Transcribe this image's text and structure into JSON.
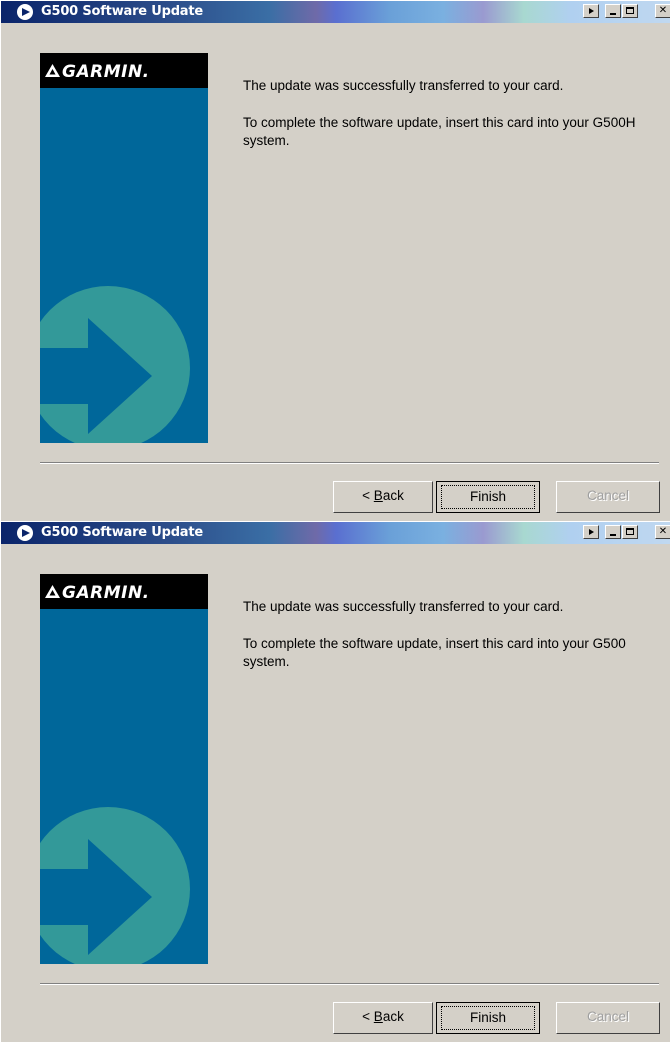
{
  "windows": [
    {
      "title": "G500 Software Update",
      "logo_text": "GARMIN.",
      "message_line1": "The update was successfully transferred to your card.",
      "message_line2": "To complete the software update, insert this card into your G500H system.",
      "back_label_prefix": "< ",
      "back_label_accel": "B",
      "back_label_rest": "ack",
      "finish_label": "Finish",
      "cancel_label": "Cancel"
    },
    {
      "title": "G500 Software Update",
      "logo_text": "GARMIN.",
      "message_line1": "The update was successfully transferred to your card.",
      "message_line2": "To complete the software update, insert this card into your G500 system.",
      "back_label_prefix": "< ",
      "back_label_accel": "B",
      "back_label_rest": "ack",
      "finish_label": "Finish",
      "cancel_label": "Cancel"
    }
  ],
  "colors": {
    "dialog_bg": "#d4d0c8",
    "banner_blue": "#00679a",
    "arrow_teal": "#339999",
    "title_bar_start": "#0a246a"
  },
  "icons": {
    "title_icon": "arrow-circle-icon",
    "logo_icon": "garmin-triangle-icon",
    "menu_button": "menu-arrow-icon",
    "minimize_button": "minimize-icon",
    "maximize_button": "maximize-icon",
    "close_button": "close-icon"
  }
}
